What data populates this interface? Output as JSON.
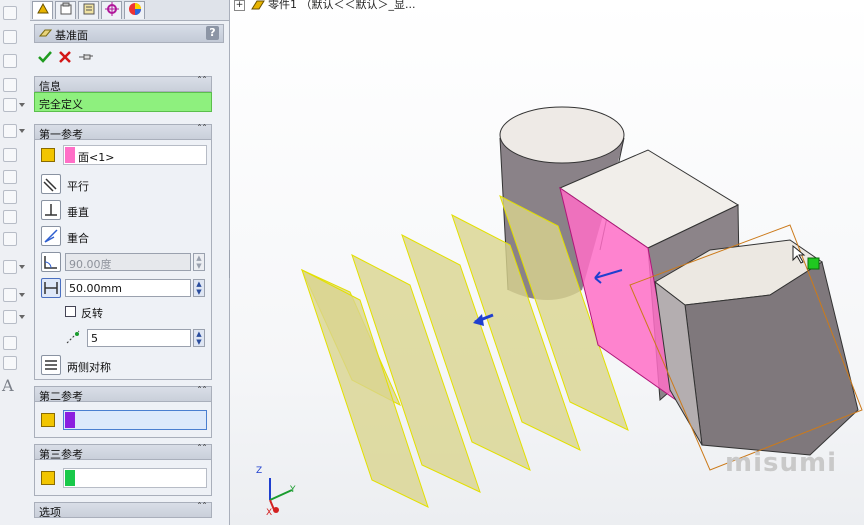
{
  "panel": {
    "title": "基准面",
    "help_label": "?",
    "info_header": "信息",
    "status_text": "完全定义",
    "first_ref": {
      "header": "第一参考",
      "selection": "面<1>",
      "parallel": "平行",
      "perpendicular": "垂直",
      "coincident": "重合",
      "angle_value": "90.00度",
      "distance_value": "50.00mm",
      "flip_label": "反转",
      "count_value": "5",
      "mid_plane": "两侧对称"
    },
    "second_ref": {
      "header": "第二参考"
    },
    "third_ref": {
      "header": "第三参考"
    },
    "options_header": "选项"
  },
  "viewport": {
    "tree_text": "零件1 （默认＜＜默认＞_显...",
    "watermark": "misumi",
    "triad_labels": {
      "z": "Z",
      "y": "Y",
      "x": "X"
    }
  },
  "icons": [
    "checkmark-icon",
    "close-icon",
    "pin-icon",
    "plane-icon",
    "feature-manager-icon",
    "property-manager-icon",
    "config-manager-icon",
    "dimxpert-icon",
    "appearance-icon"
  ],
  "colors": {
    "accent_green": "#8ef07e",
    "selection_pink": "#ff6fc7",
    "second_ref_purple": "#8b1ee0",
    "third_ref_green": "#19c94a",
    "plane_fill": "#d9d58f"
  }
}
